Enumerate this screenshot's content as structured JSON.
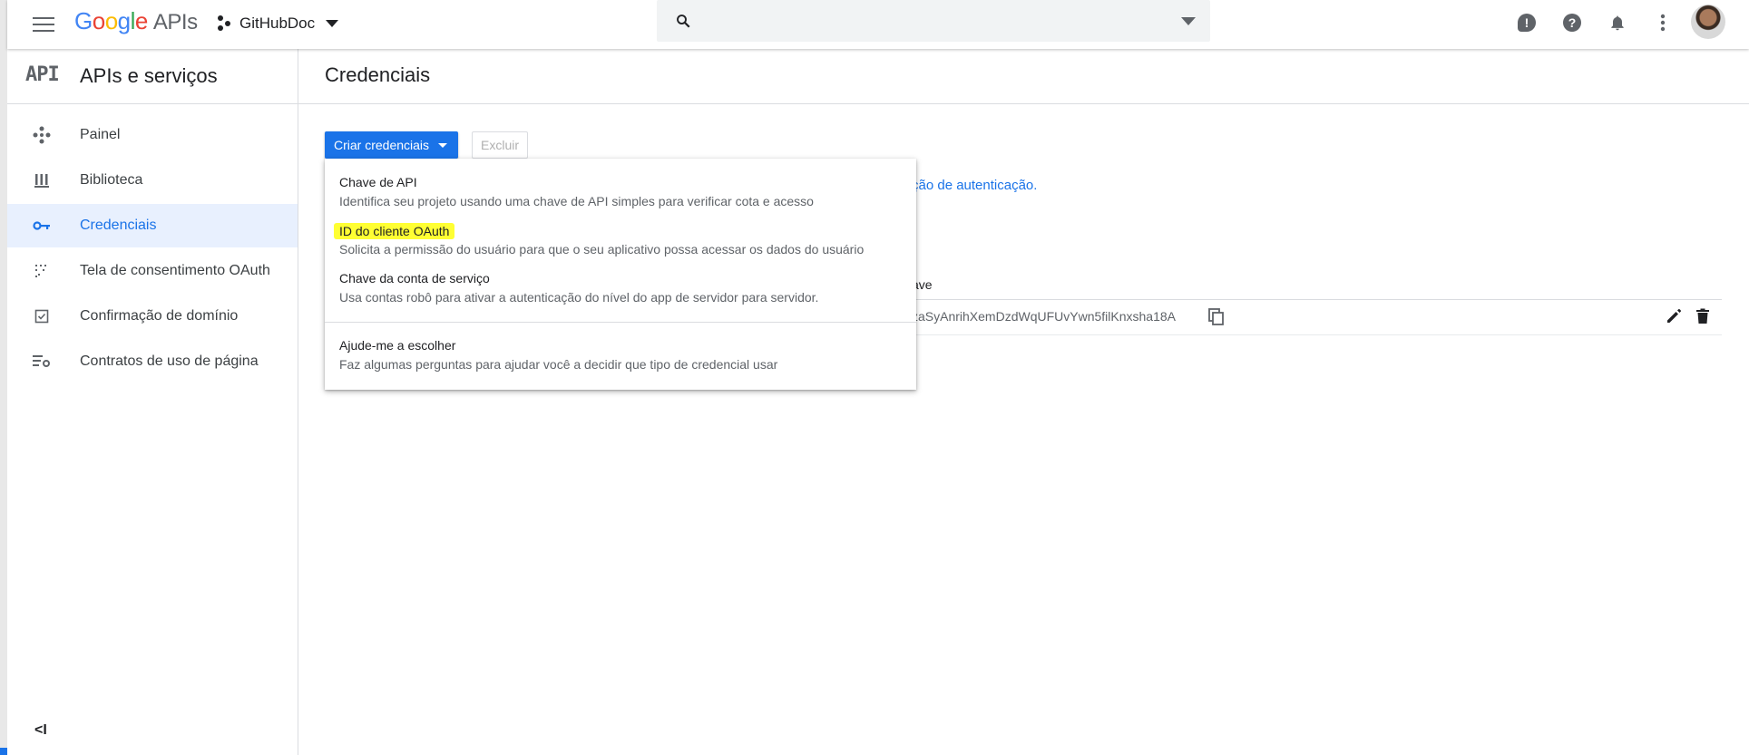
{
  "topbar": {
    "logo_letters": [
      "G",
      "o",
      "o",
      "g",
      "l",
      "e"
    ],
    "logo_suffix": "APIs",
    "project_name": "GitHubDoc",
    "search": {
      "value": "",
      "placeholder": ""
    }
  },
  "sidebar": {
    "logo": "API",
    "title": "APIs e serviços",
    "items": [
      {
        "label": "Painel",
        "icon": "dashboard-icon"
      },
      {
        "label": "Biblioteca",
        "icon": "library-icon"
      },
      {
        "label": "Credenciais",
        "icon": "key-icon",
        "active": true
      },
      {
        "label": "Tela de consentimento OAuth",
        "icon": "consent-icon"
      },
      {
        "label": "Confirmação de domínio",
        "icon": "checkbox-icon"
      },
      {
        "label": "Contratos de uso de página",
        "icon": "settings-list-icon"
      }
    ],
    "collapse_label": "<I"
  },
  "main": {
    "title": "Credenciais",
    "create_button": "Criar credenciais",
    "delete_button": "Excluir",
    "auth_link_fragment": "ção de autenticação.",
    "table": {
      "column_header_fragment": "ave",
      "key_value_fragment": "zaSyAnrihXemDzdWqUFUvYwn5filKnxsha18A"
    }
  },
  "dropdown": {
    "items": [
      {
        "title": "Chave de API",
        "desc": "Identifica seu projeto usando uma chave de API simples para verificar cota e acesso"
      },
      {
        "title": "ID do cliente OAuth",
        "desc": "Solicita a permissão do usuário para que o seu aplicativo possa acessar os dados do usuário",
        "highlighted": true
      },
      {
        "title": "Chave da conta de serviço",
        "desc": "Usa contas robô para ativar a autenticação do nível do app de servidor para servidor."
      },
      {
        "title": "Ajude-me a escolher",
        "desc": "Faz algumas perguntas para ajudar você a decidir que tipo de credencial usar"
      }
    ]
  },
  "colors": {
    "accent": "#1a73e8",
    "highlight": "#ffff33",
    "active_bg": "#e8f0fe"
  }
}
